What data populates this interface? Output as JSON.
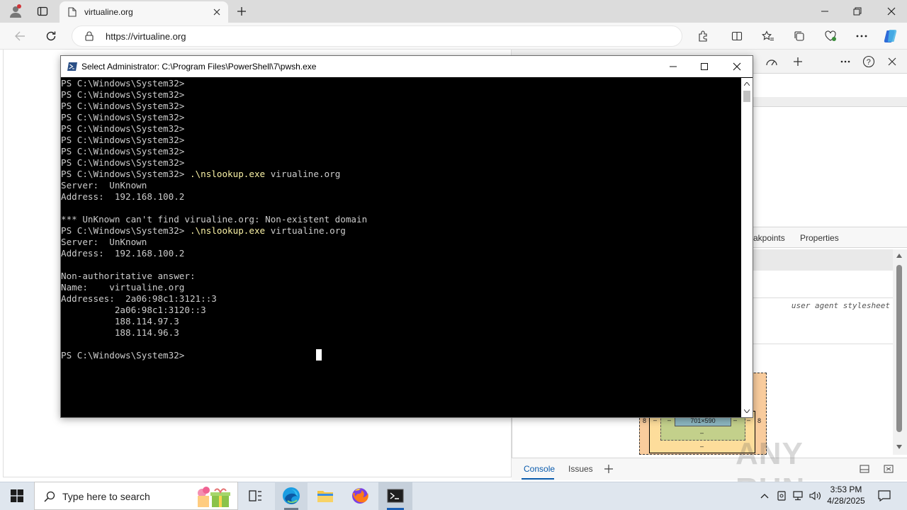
{
  "browser": {
    "tab_title": "virtualine.org",
    "url": "https://virtualine.org"
  },
  "devtools": {
    "tabs": [
      "akpoints",
      "Properties"
    ],
    "stylesheet_label": "user agent stylesheet",
    "box_model": {
      "content_size": "701×590",
      "margin_left": "8",
      "margin_right": "8",
      "border_dash": "–",
      "padding_dash": "–",
      "padding_bottom": "–",
      "border_bottom": "–"
    },
    "bottom_tabs": {
      "console": "Console",
      "issues": "Issues"
    }
  },
  "powershell": {
    "title": "Select Administrator: C:\\Program Files\\PowerShell\\7\\pwsh.exe",
    "lines": [
      {
        "prompt": "PS C:\\Windows\\System32> ",
        "cmd": "",
        "text": ""
      },
      {
        "prompt": "PS C:\\Windows\\System32> ",
        "cmd": "",
        "text": ""
      },
      {
        "prompt": "PS C:\\Windows\\System32> ",
        "cmd": "",
        "text": ""
      },
      {
        "prompt": "PS C:\\Windows\\System32> ",
        "cmd": "",
        "text": ""
      },
      {
        "prompt": "PS C:\\Windows\\System32> ",
        "cmd": "",
        "text": ""
      },
      {
        "prompt": "PS C:\\Windows\\System32> ",
        "cmd": "",
        "text": ""
      },
      {
        "prompt": "PS C:\\Windows\\System32> ",
        "cmd": "",
        "text": ""
      },
      {
        "prompt": "PS C:\\Windows\\System32> ",
        "cmd": "",
        "text": ""
      },
      {
        "prompt": "PS C:\\Windows\\System32> ",
        "cmd": ".\\nslookup.exe",
        "text": " virualine.org"
      },
      {
        "prompt": "",
        "cmd": "",
        "text": "Server:  UnKnown"
      },
      {
        "prompt": "",
        "cmd": "",
        "text": "Address:  192.168.100.2"
      },
      {
        "prompt": "",
        "cmd": "",
        "text": ""
      },
      {
        "prompt": "",
        "cmd": "",
        "text": "*** UnKnown can't find virualine.org: Non-existent domain"
      },
      {
        "prompt": "PS C:\\Windows\\System32> ",
        "cmd": ".\\nslookup.exe",
        "text": " virtualine.org"
      },
      {
        "prompt": "",
        "cmd": "",
        "text": "Server:  UnKnown"
      },
      {
        "prompt": "",
        "cmd": "",
        "text": "Address:  192.168.100.2"
      },
      {
        "prompt": "",
        "cmd": "",
        "text": ""
      },
      {
        "prompt": "",
        "cmd": "",
        "text": "Non-authoritative answer:"
      },
      {
        "prompt": "",
        "cmd": "",
        "text": "Name:    virtualine.org"
      },
      {
        "prompt": "",
        "cmd": "",
        "text": "Addresses:  2a06:98c1:3121::3"
      },
      {
        "prompt": "",
        "cmd": "",
        "text": "          2a06:98c1:3120::3"
      },
      {
        "prompt": "",
        "cmd": "",
        "text": "          188.114.97.3"
      },
      {
        "prompt": "",
        "cmd": "",
        "text": "          188.114.96.3"
      },
      {
        "prompt": "",
        "cmd": "",
        "text": ""
      },
      {
        "prompt": "PS C:\\Windows\\System32> ",
        "cmd": "",
        "text": ""
      }
    ]
  },
  "taskbar": {
    "search_placeholder": "Type here to search",
    "time": "3:53 PM",
    "date": "4/28/2025"
  },
  "watermark": "ANY RUN",
  "colors": {
    "console_bg": "#000000",
    "console_text": "#cccccc",
    "command_text": "#f9f1a5",
    "taskbar_bg": "#dfe6ee",
    "edge_blue": "#0c59a4"
  }
}
